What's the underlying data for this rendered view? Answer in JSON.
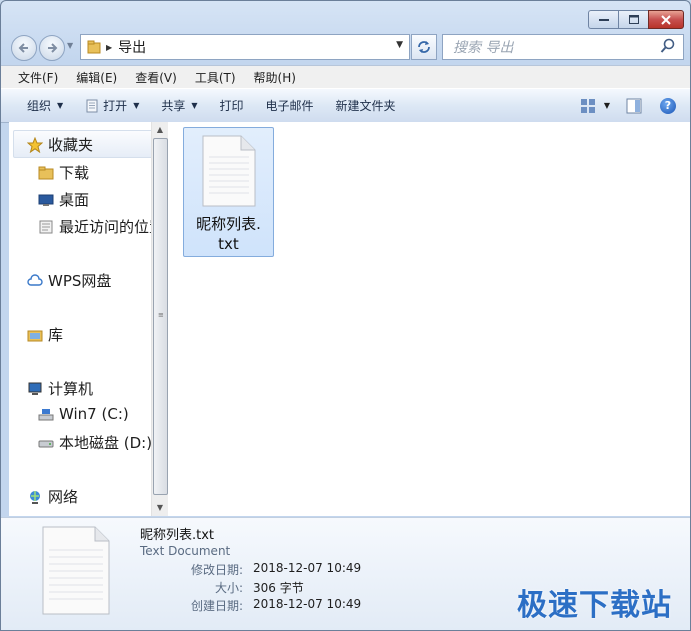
{
  "window": {
    "caption_buttons": [
      "minimize",
      "maximize",
      "close"
    ]
  },
  "address_bar": {
    "breadcrumb": [
      "导出"
    ]
  },
  "search": {
    "placeholder": "搜索 导出"
  },
  "menu": {
    "items": [
      "文件(F)",
      "编辑(E)",
      "查看(V)",
      "工具(T)",
      "帮助(H)"
    ]
  },
  "toolbar": {
    "organize": "组织",
    "open": "打开",
    "share": "共享",
    "print": "打印",
    "email": "电子邮件",
    "new_folder": "新建文件夹"
  },
  "nav_pane": {
    "favorites": "收藏夹",
    "downloads": "下载",
    "desktop": "桌面",
    "recent": "最近访问的位置",
    "wps": "WPS网盘",
    "library": "库",
    "computer": "计算机",
    "drive_c": "Win7 (C:)",
    "drive_d": "本地磁盘 (D:)",
    "network": "网络"
  },
  "files": [
    {
      "name_line1": "昵称列表.",
      "name_line2": "txt"
    }
  ],
  "details": {
    "file_name": "昵称列表.txt",
    "file_type": "Text Document",
    "modified_label": "修改日期:",
    "modified_value": "2018-12-07 10:49",
    "size_label": "大小:",
    "size_value": "306 字节",
    "created_label": "创建日期:",
    "created_value": "2018-12-07 10:49"
  },
  "watermark": "极速下载站",
  "colors": {
    "accent": "#3567a8",
    "selection": "#cfe3fb",
    "watermark": "#2c6fc5"
  }
}
